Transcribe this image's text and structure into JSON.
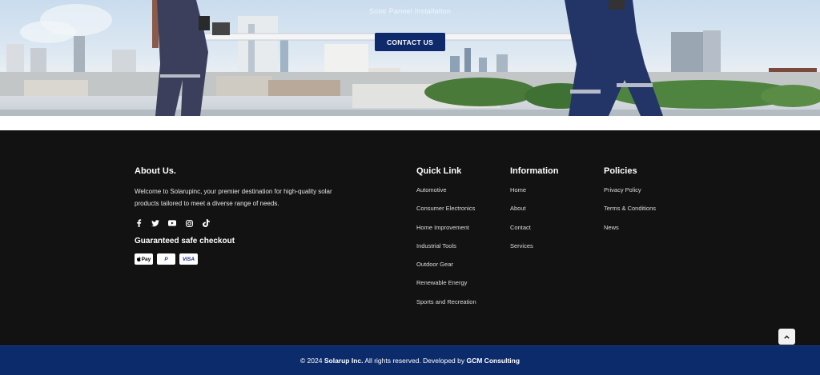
{
  "hero": {
    "subtitle": "Solar Pannel Installation",
    "cta_label": "CONTACT US",
    "cta_color": "#0e2a6b"
  },
  "about": {
    "title": "About Us.",
    "text": "Welcome to Solarupinc, your premier destination for high-quality solar products tailored to meet a diverse range of needs.",
    "socials": [
      "facebook-icon",
      "twitter-icon",
      "youtube-icon",
      "instagram-icon",
      "tiktok-icon"
    ],
    "checkout_title": "Guaranteed safe checkout",
    "payments": [
      "Pay",
      "P",
      "VISA"
    ]
  },
  "quick_link": {
    "title": "Quick Link",
    "items": [
      "Automotive",
      "Consumer Electronics",
      "Home Improvement",
      "Industrial Tools",
      "Outdoor Gear",
      "Renewable Energy",
      "Sports and Recreation"
    ]
  },
  "information": {
    "title": "Information",
    "items": [
      "Home",
      "About",
      "Contact",
      "Services"
    ]
  },
  "policies": {
    "title": "Policies",
    "items": [
      "Privacy Policy",
      "Terms & Conditions",
      "News"
    ]
  },
  "bottom": {
    "prefix": "© 2024 ",
    "company": "Solarup Inc.",
    "middle": " All rights reserved. Developed by ",
    "developer": "GCM Consulting",
    "bar_color": "#0c2b6b"
  }
}
